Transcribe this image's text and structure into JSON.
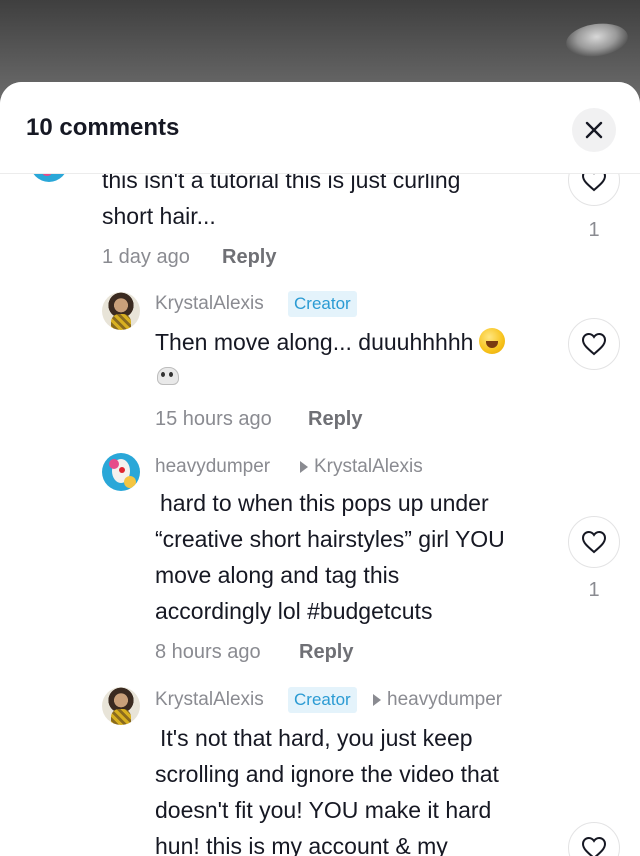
{
  "header": {
    "title": "10 comments",
    "close_icon": "close-icon"
  },
  "comments": [
    {
      "text_line1": "this isn't a tutorial this is just curling",
      "text_line2": "short hair...",
      "time": "1 day ago",
      "reply_label": "Reply",
      "likes": "1"
    },
    {
      "username": "KrystalAlexis",
      "badge": "Creator",
      "text_line1": "Then move along... duuuhhhhh",
      "time": "15 hours ago",
      "reply_label": "Reply"
    },
    {
      "username": "heavydumper",
      "reply_to": "KrystalAlexis",
      "text_line1": "hard to when this pops up under",
      "text_line2": "“creative short hairstyles” girl YOU",
      "text_line3": "move along and tag this",
      "text_line4": "accordingly lol #budgetcuts",
      "time": "8 hours ago",
      "reply_label": "Reply",
      "likes": "1"
    },
    {
      "username": "KrystalAlexis",
      "badge": "Creator",
      "reply_to": "heavydumper",
      "text_line1": "It's not that hard, you just keep",
      "text_line2": "scrolling and ignore the video that",
      "text_line3": "doesn't fit you! YOU make it hard",
      "text_line4": "hun! this is my account & my"
    }
  ],
  "colors": {
    "accent_creator": "#2b9bd3",
    "text_primary": "#161823",
    "text_secondary": "#8a8b91"
  }
}
